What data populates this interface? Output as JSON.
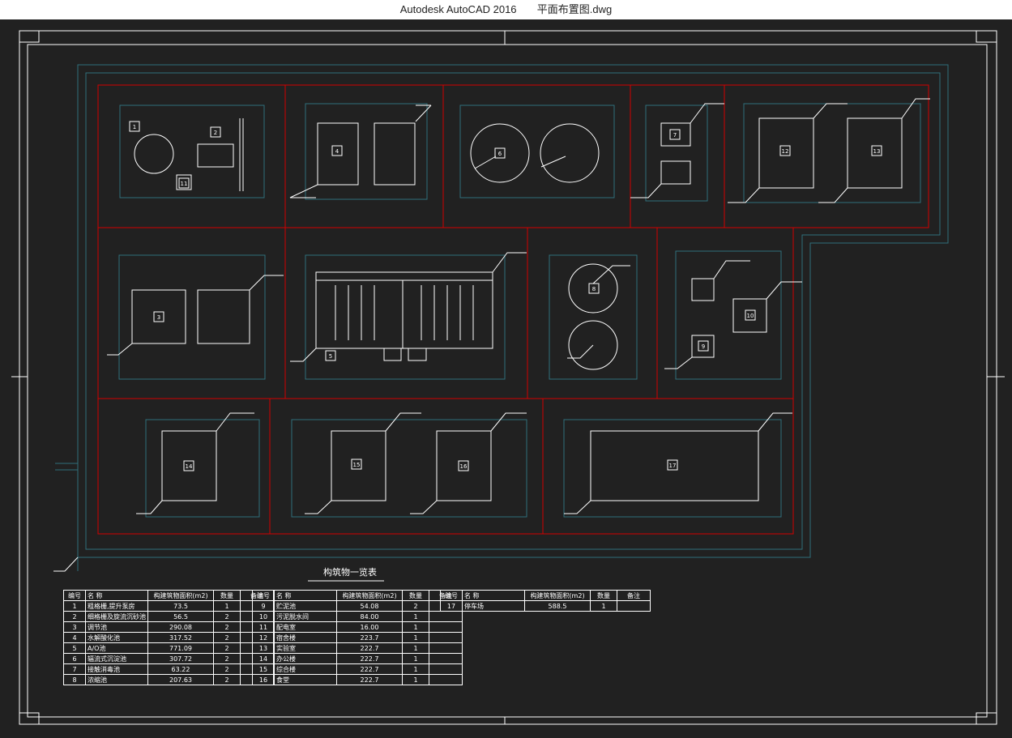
{
  "window": {
    "app_title": "Autodesk AutoCAD 2016",
    "file_name": "平面布置图.dwg"
  },
  "drawing": {
    "buildings": [
      {
        "no": "1"
      },
      {
        "no": "2"
      },
      {
        "no": "3"
      },
      {
        "no": "4"
      },
      {
        "no": "5"
      },
      {
        "no": "6"
      },
      {
        "no": "7"
      },
      {
        "no": "8"
      },
      {
        "no": "9"
      },
      {
        "no": "10"
      },
      {
        "no": "11"
      },
      {
        "no": "12"
      },
      {
        "no": "13"
      },
      {
        "no": "14"
      },
      {
        "no": "15"
      },
      {
        "no": "16"
      },
      {
        "no": "17"
      }
    ]
  },
  "schedule": {
    "title": "构筑物一览表",
    "headers": [
      "编号",
      "名 称",
      "构建筑物面积(m2)",
      "数量",
      "备注"
    ],
    "col1": [
      {
        "no": "1",
        "name": "粗格栅,提升泵房",
        "area": "73.5",
        "qty": "1",
        "note": ""
      },
      {
        "no": "2",
        "name": "细格栅及旋流沉砂池",
        "area": "56.5",
        "qty": "2",
        "note": ""
      },
      {
        "no": "3",
        "name": "调节池",
        "area": "290.08",
        "qty": "2",
        "note": ""
      },
      {
        "no": "4",
        "name": "水解酸化池",
        "area": "317.52",
        "qty": "2",
        "note": ""
      },
      {
        "no": "5",
        "name": "A/O池",
        "area": "771.09",
        "qty": "2",
        "note": ""
      },
      {
        "no": "6",
        "name": "辐流式沉淀池",
        "area": "307.72",
        "qty": "2",
        "note": ""
      },
      {
        "no": "7",
        "name": "接触消毒池",
        "area": "63.22",
        "qty": "2",
        "note": ""
      },
      {
        "no": "8",
        "name": "浓缩池",
        "area": "207.63",
        "qty": "2",
        "note": ""
      }
    ],
    "col2": [
      {
        "no": "9",
        "name": "贮泥池",
        "area": "54.08",
        "qty": "2",
        "note": ""
      },
      {
        "no": "10",
        "name": "污泥脱水间",
        "area": "84.00",
        "qty": "1",
        "note": ""
      },
      {
        "no": "11",
        "name": "配电室",
        "area": "16.00",
        "qty": "1",
        "note": ""
      },
      {
        "no": "12",
        "name": "宿舍楼",
        "area": "223.7",
        "qty": "1",
        "note": ""
      },
      {
        "no": "13",
        "name": "实验室",
        "area": "222.7",
        "qty": "1",
        "note": ""
      },
      {
        "no": "14",
        "name": "办公楼",
        "area": "222.7",
        "qty": "1",
        "note": ""
      },
      {
        "no": "15",
        "name": "综合楼",
        "area": "222.7",
        "qty": "1",
        "note": ""
      },
      {
        "no": "16",
        "name": "食堂",
        "area": "222.7",
        "qty": "1",
        "note": ""
      }
    ],
    "col3": [
      {
        "no": "17",
        "name": "停车场",
        "area": "588.5",
        "qty": "1",
        "note": ""
      }
    ]
  },
  "colors": {
    "background": "#212121",
    "border": "#ffffff",
    "zone_lines": "#d40000",
    "road_lines": "#2f6f7a",
    "structure_lines": "#ffffff"
  }
}
